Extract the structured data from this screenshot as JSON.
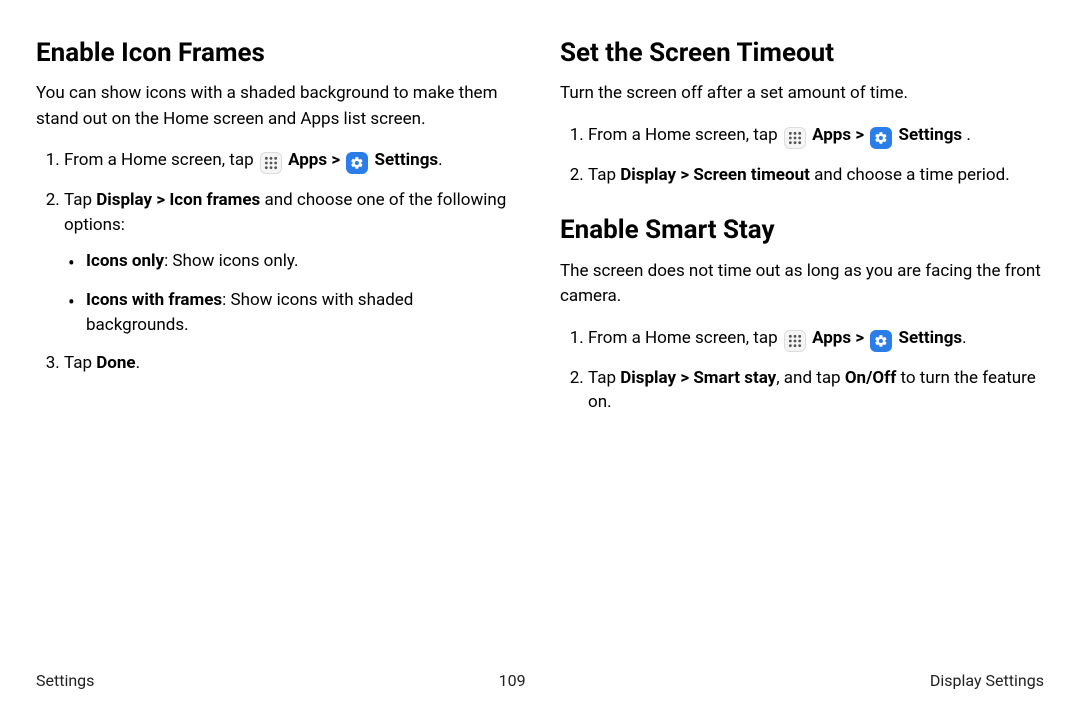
{
  "left": {
    "h_iconFrames": "Enable Icon Frames",
    "intro_iconFrames": "You can show icons with a shaded background to make them stand out on the Home screen and Apps list screen.",
    "step1_pre": "From a Home screen, tap",
    "apps": "Apps",
    "settings": "Settings",
    "step2_pre": "Tap ",
    "step2_bold": "Display > Icon frames",
    "step2_post": " and choose one of the following options:",
    "opt1_bold": "Icons only",
    "opt1_post": ": Show icons only.",
    "opt2_bold": "Icons with frames",
    "opt2_post": ": Show icons with shaded backgrounds.",
    "step3_pre": "Tap ",
    "step3_bold": "Done",
    "step3_post": "."
  },
  "right": {
    "h_timeout": "Set the Screen Timeout",
    "intro_timeout": "Turn the screen off after a set amount of time.",
    "step1_pre": "From a Home screen, tap",
    "apps": "Apps",
    "settings": "Settings",
    "t_step2_pre": "Tap ",
    "t_step2_bold": "Display > Screen timeout",
    "t_step2_post": " and choose a time period.",
    "h_smart": "Enable Smart Stay",
    "intro_smart": "The screen does not time out as long as you are facing the front camera.",
    "s_step2_pre": "Tap ",
    "s_step2_bold1": "Display > Smart stay",
    "s_step2_mid": ", and tap ",
    "s_step2_bold2": "On/Off",
    "s_step2_post": " to turn the feature on."
  },
  "footer": {
    "left": "Settings",
    "center": "109",
    "right": "Display Settings"
  },
  "icons": {
    "chevron": ">"
  }
}
